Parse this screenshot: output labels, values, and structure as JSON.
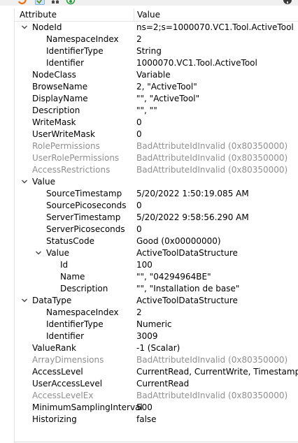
{
  "header": {
    "attribute": "Attribute",
    "value": "Value"
  },
  "rows": [
    {
      "name": "NodeId",
      "value": "ns=2;s=1000070.VC1.Tool.ActiveTool",
      "level": 0,
      "expanded": true
    },
    {
      "name": "NamespaceIndex",
      "value": "2",
      "level": 1
    },
    {
      "name": "IdentifierType",
      "value": "String",
      "level": 1
    },
    {
      "name": "Identifier",
      "value": "1000070.VC1.Tool.ActiveTool",
      "level": 1
    },
    {
      "name": "NodeClass",
      "value": "Variable",
      "level": 0
    },
    {
      "name": "BrowseName",
      "value": "2, \"ActiveTool\"",
      "level": 0
    },
    {
      "name": "DisplayName",
      "value": "\"\", \"ActiveTool\"",
      "level": 0
    },
    {
      "name": "Description",
      "value": "\"\", \"\"",
      "level": 0
    },
    {
      "name": "WriteMask",
      "value": "0",
      "level": 0
    },
    {
      "name": "UserWriteMask",
      "value": "0",
      "level": 0
    },
    {
      "name": "RolePermissions",
      "value": "BadAttributeIdInvalid (0x80350000)",
      "level": 0,
      "dim": true
    },
    {
      "name": "UserRolePermissions",
      "value": "BadAttributeIdInvalid (0x80350000)",
      "level": 0,
      "dim": true
    },
    {
      "name": "AccessRestrictions",
      "value": "BadAttributeIdInvalid (0x80350000)",
      "level": 0,
      "dim": true
    },
    {
      "name": "Value",
      "value": "",
      "level": 0,
      "expanded": true
    },
    {
      "name": "SourceTimestamp",
      "value": "5/20/2022 1:50:19.085 AM",
      "level": 1
    },
    {
      "name": "SourcePicoseconds",
      "value": "0",
      "level": 1
    },
    {
      "name": "ServerTimestamp",
      "value": "5/20/2022 9:58:56.290 AM",
      "level": 1
    },
    {
      "name": "ServerPicoseconds",
      "value": "0",
      "level": 1
    },
    {
      "name": "StatusCode",
      "value": "Good (0x00000000)",
      "level": 1
    },
    {
      "name": "Value",
      "value": "ActiveToolDataStructure",
      "level": 1,
      "expanded": true
    },
    {
      "name": "Id",
      "value": "100",
      "level": 2
    },
    {
      "name": "Name",
      "value": "\"\", \"04294964BE\"",
      "level": 2
    },
    {
      "name": "Description",
      "value": "\"\", \"Installation de base\"",
      "level": 2
    },
    {
      "name": "DataType",
      "value": "ActiveToolDataStructure",
      "level": 0,
      "expanded": true
    },
    {
      "name": "NamespaceIndex",
      "value": "2",
      "level": 1
    },
    {
      "name": "IdentifierType",
      "value": "Numeric",
      "level": 1
    },
    {
      "name": "Identifier",
      "value": "3009",
      "level": 1
    },
    {
      "name": "ValueRank",
      "value": "-1 (Scalar)",
      "level": 0
    },
    {
      "name": "ArrayDimensions",
      "value": "BadAttributeIdInvalid (0x80350000)",
      "level": 0,
      "dim": true
    },
    {
      "name": "AccessLevel",
      "value": "CurrentRead, CurrentWrite, TimestampWrite",
      "level": 0
    },
    {
      "name": "UserAccessLevel",
      "value": "CurrentRead",
      "level": 0
    },
    {
      "name": "AccessLevelEx",
      "value": "BadAttributeIdInvalid (0x80350000)",
      "level": 0,
      "dim": true
    },
    {
      "name": "MinimumSamplingInterval",
      "value": "500",
      "level": 0
    },
    {
      "name": "Historizing",
      "value": "false",
      "level": 0
    }
  ],
  "colors": {
    "dim_text": "#8f8f8f",
    "grid_line": "#e5e5e5",
    "toolbar_bg": "#f0f0f0"
  }
}
